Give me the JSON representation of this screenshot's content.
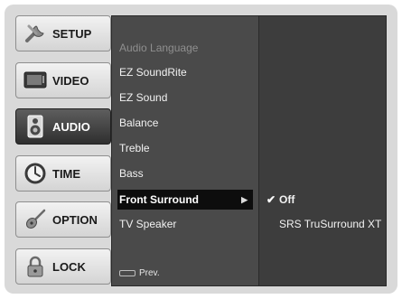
{
  "tabs": [
    {
      "label": "SETUP",
      "icon": "wrench-icon",
      "active": false
    },
    {
      "label": "VIDEO",
      "icon": "monitor-icon",
      "active": false
    },
    {
      "label": "AUDIO",
      "icon": "speaker-icon",
      "active": true
    },
    {
      "label": "TIME",
      "icon": "clock-icon",
      "active": false
    },
    {
      "label": "OPTION",
      "icon": "guitar-icon",
      "active": false
    },
    {
      "label": "LOCK",
      "icon": "lock-icon",
      "active": false
    }
  ],
  "audio_menu": {
    "items": [
      {
        "label": "Audio Language",
        "state": "disabled"
      },
      {
        "label": "EZ SoundRite",
        "state": "normal"
      },
      {
        "label": "EZ Sound",
        "state": "normal"
      },
      {
        "label": "Balance",
        "state": "normal"
      },
      {
        "label": "Treble",
        "state": "normal"
      },
      {
        "label": "Bass",
        "state": "normal"
      },
      {
        "label": "Front Surround",
        "state": "highlighted"
      },
      {
        "label": "TV Speaker",
        "state": "normal"
      }
    ],
    "submenu_arrow": "▶",
    "prev_label": "Prev."
  },
  "front_surround_options": {
    "check_mark": "✔",
    "items": [
      {
        "label": "Off",
        "selected": true
      },
      {
        "label": "SRS TruSurround XT",
        "selected": false
      }
    ]
  },
  "colors": {
    "panel_bg": "#d9d9d9",
    "menu_bg": "#4a4a4a",
    "options_bg": "#3d3d3d",
    "highlight": "#0d0d0d",
    "active_tab": "#3f3f3f"
  }
}
